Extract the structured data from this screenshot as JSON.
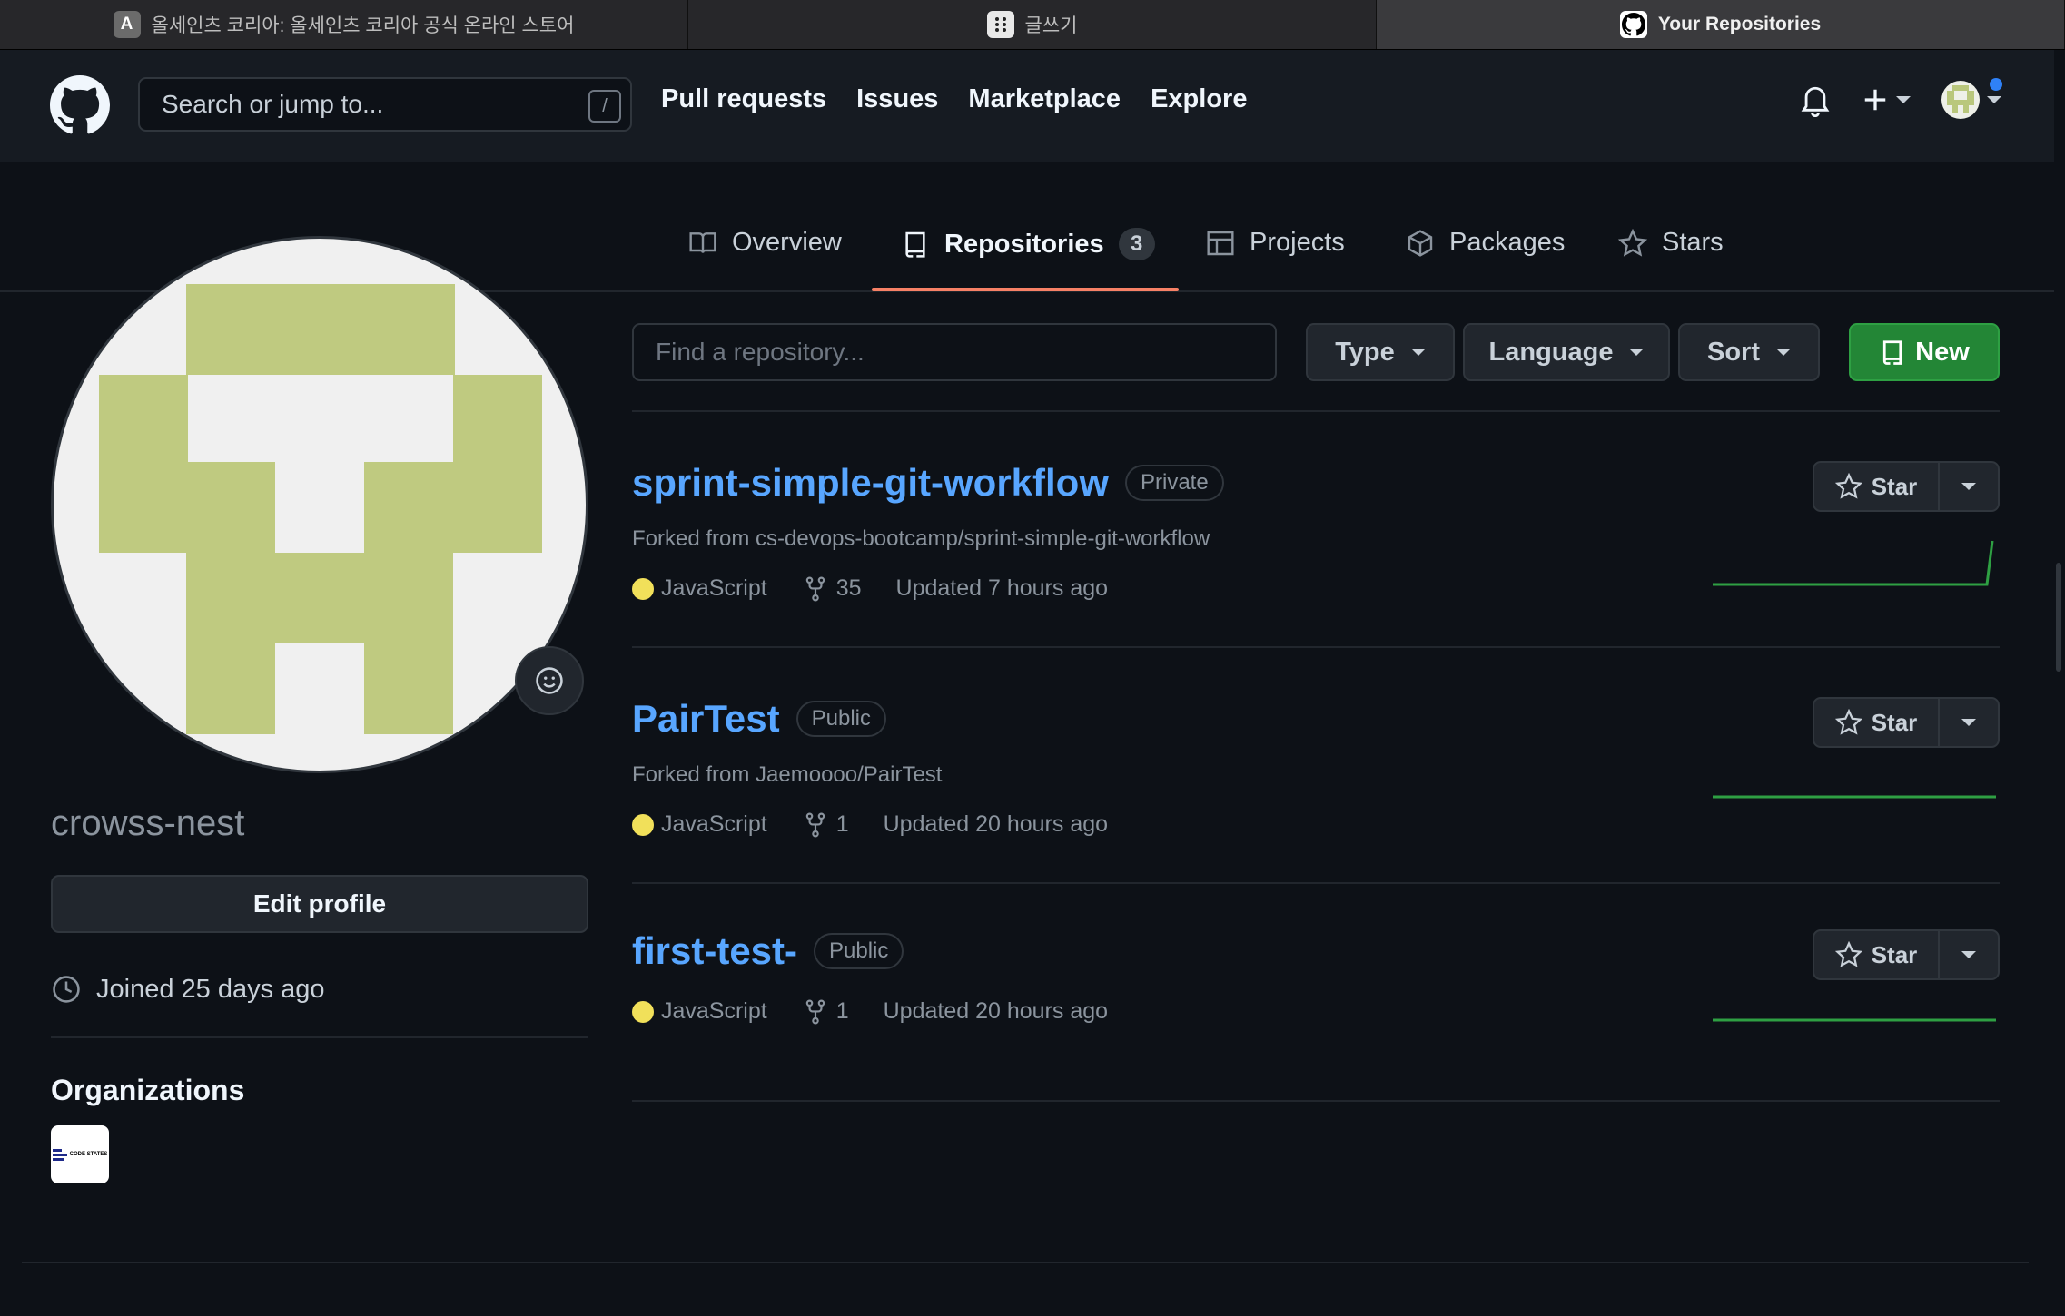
{
  "browser": {
    "tabs": [
      {
        "favicon": "A",
        "title": "올세인츠 코리아: 올세인츠 코리아 공식 온라인 스토어",
        "active": false
      },
      {
        "favicon": "dots-icon",
        "title": "글쓰기",
        "active": false
      },
      {
        "favicon": "github-icon",
        "title": "Your Repositories",
        "active": true
      }
    ]
  },
  "header": {
    "search_placeholder": "Search or jump to...",
    "search_shortcut": "/",
    "nav": [
      "Pull requests",
      "Issues",
      "Marketplace",
      "Explore"
    ]
  },
  "profile_tabs": {
    "overview": "Overview",
    "repositories": "Repositories",
    "repositories_count": "3",
    "projects": "Projects",
    "packages": "Packages",
    "stars": "Stars"
  },
  "sidebar": {
    "username": "crowss-nest",
    "edit_profile": "Edit profile",
    "joined": "Joined 25 days ago",
    "organizations_heading": "Organizations",
    "org_logo_text": "CODE STATES"
  },
  "filters": {
    "find_placeholder": "Find a repository...",
    "type": "Type",
    "language": "Language",
    "sort": "Sort",
    "new": "New"
  },
  "repos": [
    {
      "name": "sprint-simple-git-workflow",
      "visibility": "Private",
      "forked_from": "Forked from cs-devops-bootcamp/sprint-simple-git-workflow",
      "language": "JavaScript",
      "forks": "35",
      "updated": "Updated 7 hours ago",
      "star_label": "Star"
    },
    {
      "name": "PairTest",
      "visibility": "Public",
      "forked_from": "Forked from Jaemoooo/PairTest",
      "language": "JavaScript",
      "forks": "1",
      "updated": "Updated 20 hours ago",
      "star_label": "Star"
    },
    {
      "name": "first-test-",
      "visibility": "Public",
      "forked_from": "",
      "language": "JavaScript",
      "forks": "1",
      "updated": "Updated 20 hours ago",
      "star_label": "Star"
    }
  ],
  "colors": {
    "accent_link": "#58a6ff",
    "javascript": "#f1e05a",
    "new_button": "#238636",
    "tab_underline": "#f78166",
    "avatar_green": "#bfca80"
  }
}
